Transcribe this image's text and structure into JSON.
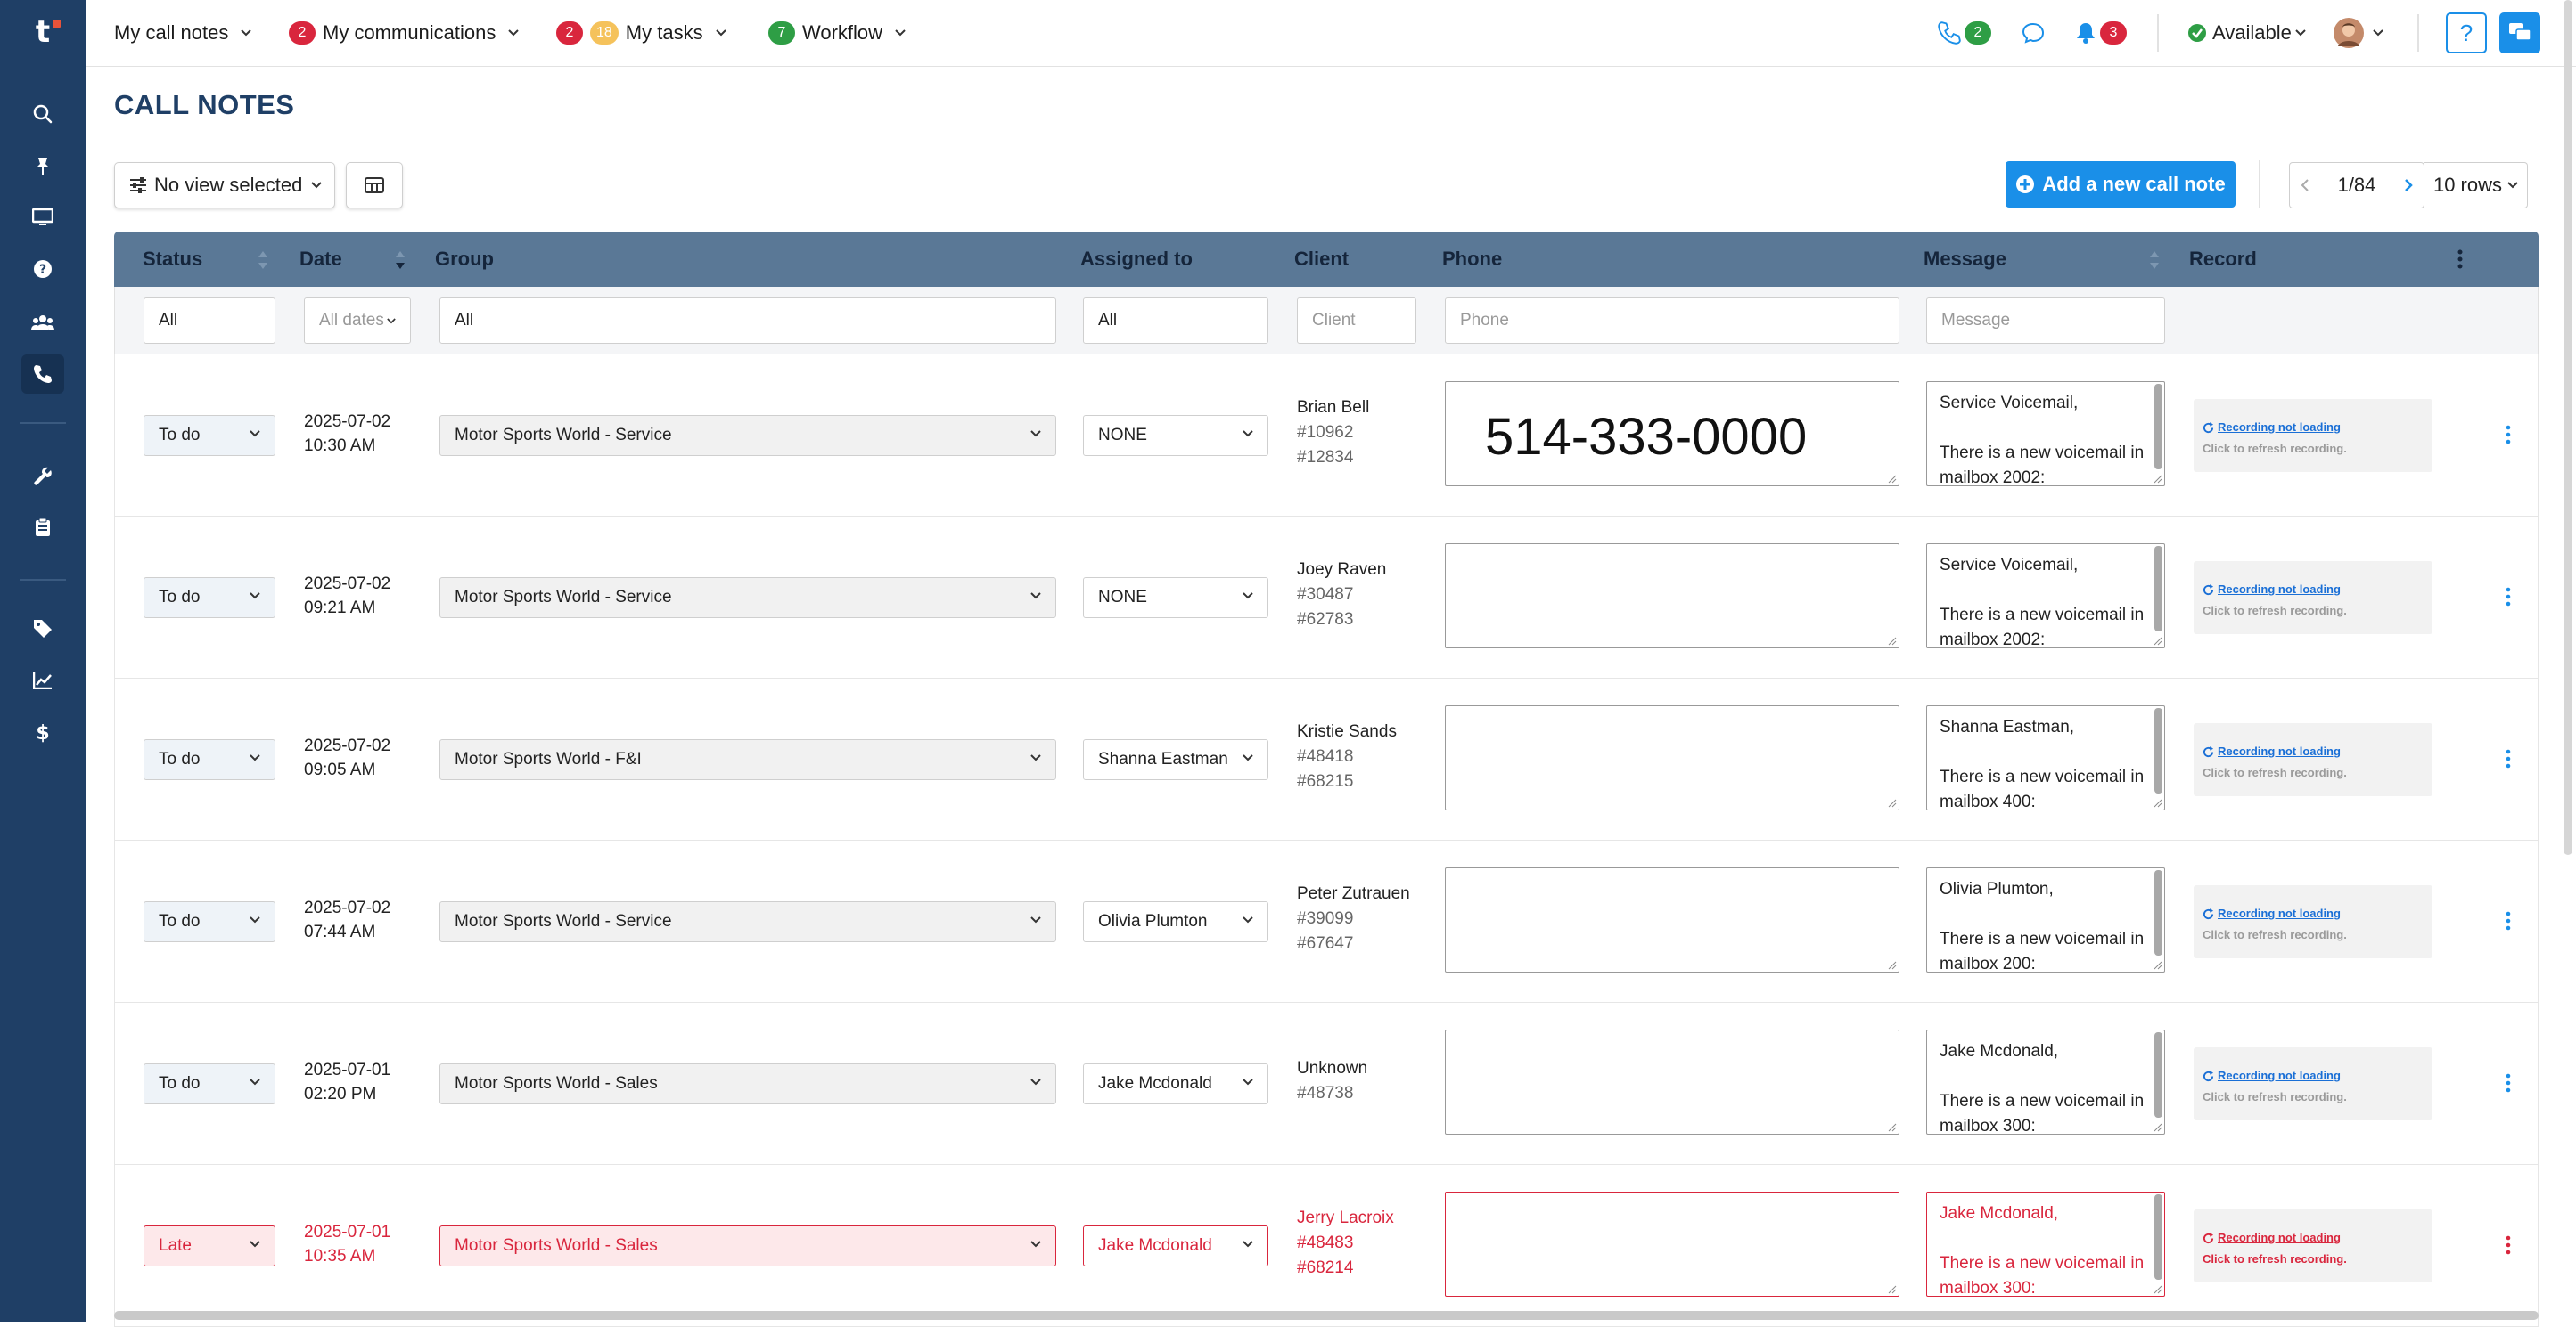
{
  "nav": {
    "call_notes": "My call notes",
    "communications": {
      "label": "My communications",
      "badge": "2"
    },
    "tasks": {
      "label": "My tasks",
      "badge_red": "2",
      "badge_yellow": "18"
    },
    "workflow": {
      "label": "Workflow",
      "badge": "7"
    }
  },
  "topright": {
    "phone_badge": "2",
    "bell_badge": "3",
    "status": "Available",
    "help": "?"
  },
  "page": {
    "title": "CALL NOTES",
    "view_label": "No view selected",
    "add_button": "Add a new call note",
    "pager": "1/84",
    "rows": "10 rows"
  },
  "columns": {
    "status": "Status",
    "date": "Date",
    "group": "Group",
    "assigned": "Assigned to",
    "client": "Client",
    "phone": "Phone",
    "message": "Message",
    "record": "Record"
  },
  "filters": {
    "status": "All",
    "date": "All dates",
    "group": "All",
    "assigned": "All",
    "client_ph": "Client",
    "phone_ph": "Phone",
    "message_ph": "Message"
  },
  "record": {
    "link": "Recording not loading",
    "hint": "Click to refresh recording."
  },
  "rows": [
    {
      "status": "To do",
      "date": "2025-07-02",
      "time": "10:30 AM",
      "group": "Motor Sports World - Service",
      "assigned": "NONE",
      "client": "Brian Bell",
      "id1": "#10962",
      "id2": "#12834",
      "phone": "514-333-0000",
      "msg1": "Service Voicemail,",
      "msg2": "There is a new voicemail in mailbox 2002:"
    },
    {
      "status": "To do",
      "date": "2025-07-02",
      "time": "09:21 AM",
      "group": "Motor Sports World - Service",
      "assigned": "NONE",
      "client": "Joey Raven",
      "id1": "#30487",
      "id2": "#62783",
      "phone": "",
      "msg1": "Service Voicemail,",
      "msg2": "There is a new voicemail in mailbox 2002:"
    },
    {
      "status": "To do",
      "date": "2025-07-02",
      "time": "09:05 AM",
      "group": "Motor Sports World - F&I",
      "assigned": "Shanna Eastman",
      "client": "Kristie Sands",
      "id1": "#48418",
      "id2": "#68215",
      "phone": "",
      "msg1": "Shanna Eastman,",
      "msg2": "There is a new voicemail in mailbox 400:"
    },
    {
      "status": "To do",
      "date": "2025-07-02",
      "time": "07:44 AM",
      "group": "Motor Sports World - Service",
      "assigned": "Olivia Plumton",
      "client": "Peter Zutrauen",
      "id1": "#39099",
      "id2": "#67647",
      "phone": "",
      "msg1": "Olivia Plumton,",
      "msg2": "There is a new voicemail in mailbox 200:"
    },
    {
      "status": "To do",
      "date": "2025-07-01",
      "time": "02:20 PM",
      "group": "Motor Sports World - Sales",
      "assigned": "Jake Mcdonald",
      "client": "Unknown",
      "id1": "#48738",
      "id2": "",
      "phone": "",
      "msg1": "Jake Mcdonald,",
      "msg2": "There is a new voicemail in mailbox 300:"
    },
    {
      "status": "Late",
      "date": "2025-07-01",
      "time": "10:35 AM",
      "group": "Motor Sports World - Sales",
      "assigned": "Jake Mcdonald",
      "client": "Jerry Lacroix",
      "id1": "#48483",
      "id2": "#68214",
      "phone": "",
      "msg1": "Jake Mcdonald,",
      "msg2": "There is a new voicemail in mailbox 300:"
    }
  ],
  "colors": {
    "sidebar": "#1f3f66",
    "accent": "#1a8fe8",
    "header": "#5a7896",
    "late": "#d9263d"
  },
  "icons": {
    "sidebar": [
      "search-icon",
      "pin-icon",
      "monitor-icon",
      "help-icon",
      "users-icon",
      "phone-icon",
      "wrench-icon",
      "clipboard-icon",
      "tag-icon",
      "chart-icon",
      "dollar-icon"
    ]
  }
}
